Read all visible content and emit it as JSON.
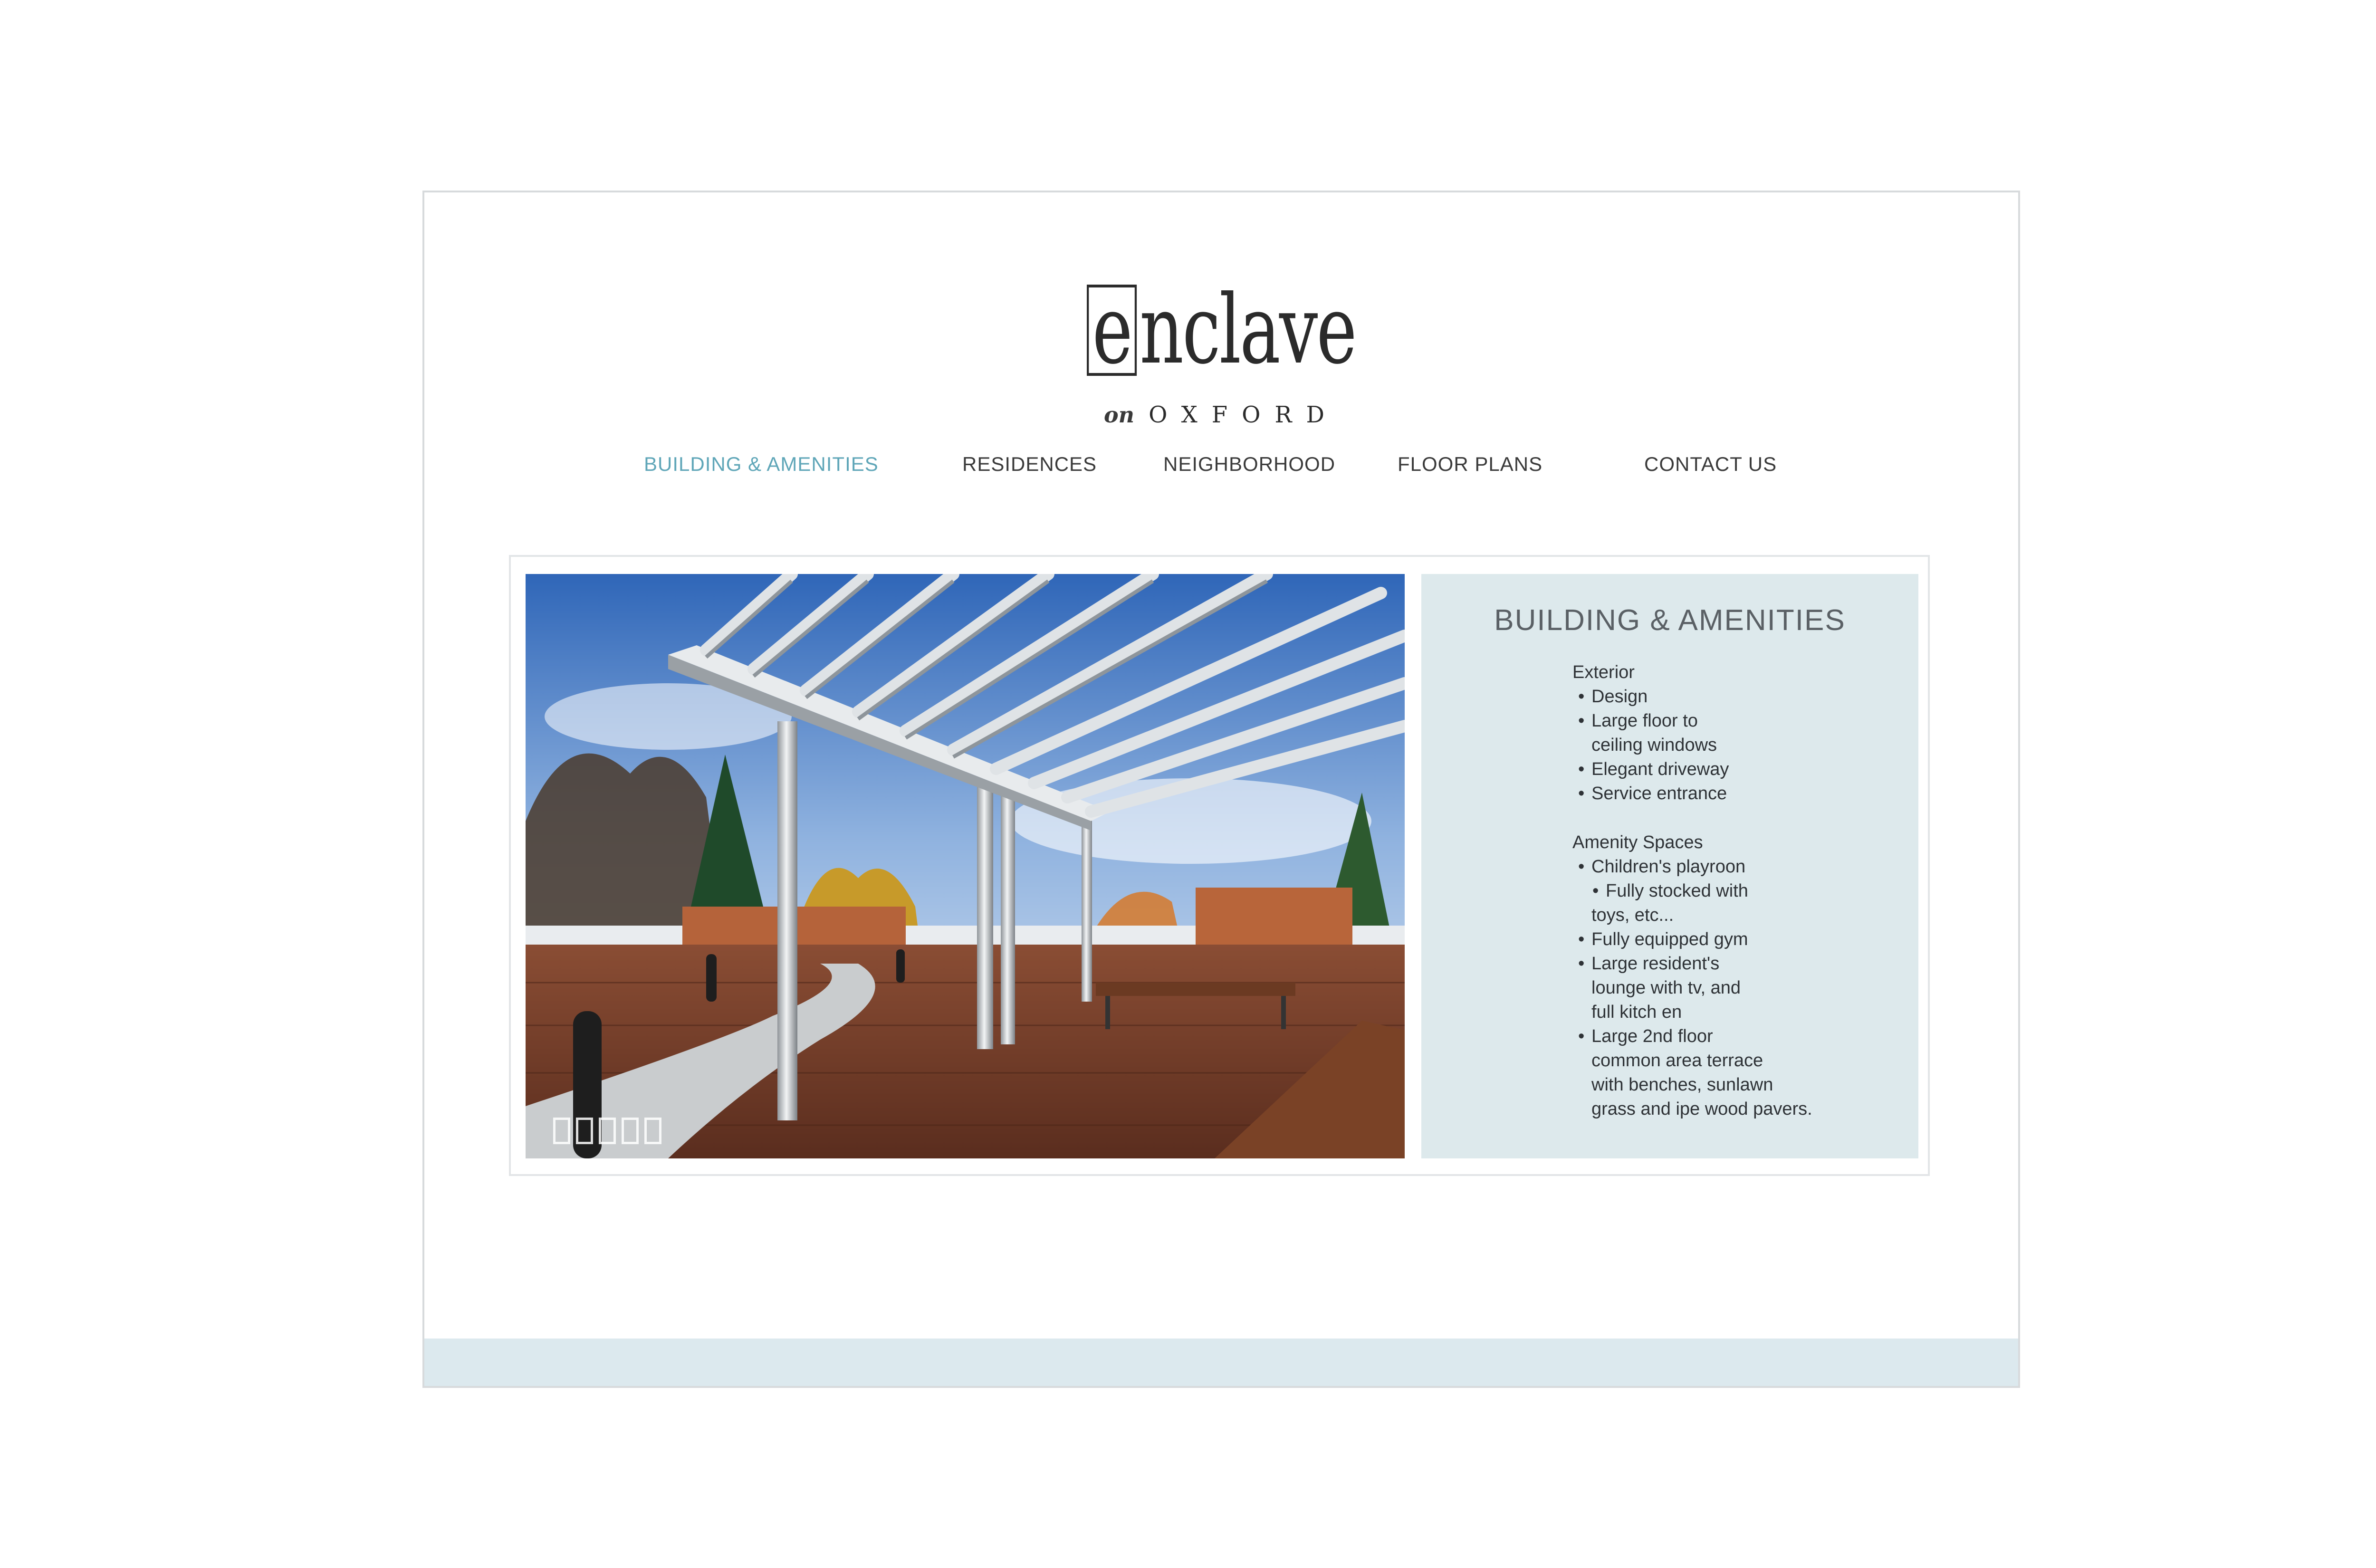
{
  "logo": {
    "first_letter": "e",
    "rest": "nclave",
    "on": "on",
    "place": "OXFORD"
  },
  "nav": {
    "items": [
      {
        "label": "BUILDING & AMENITIES",
        "active": true
      },
      {
        "label": "RESIDENCES",
        "active": false
      },
      {
        "label": "NEIGHBORHOOD",
        "active": false
      },
      {
        "label": "FLOOR PLANS",
        "active": false
      },
      {
        "label": "CONTACT US",
        "active": false
      }
    ]
  },
  "slideshow": {
    "slide_count": 5,
    "current_slide": 1
  },
  "panel": {
    "title": "BUILDING & AMENITIES",
    "exterior": {
      "heading": "Exterior",
      "design": "Design",
      "windows_1": "Large floor to",
      "windows_2": "ceiling windows",
      "driveway": "Elegant driveway",
      "service": "Service entrance"
    },
    "amenity": {
      "heading": "Amenity Spaces",
      "playroom": "Children's playroon",
      "stocked_1": "Fully stocked with",
      "stocked_2": "toys, etc...",
      "gym": "Fully equipped gym",
      "lounge_1": "Large resident's",
      "lounge_2": "lounge with tv, and",
      "lounge_3": "full kitch en",
      "terrace_1": "Large 2nd floor",
      "terrace_2": "common area terrace",
      "terrace_3": "with benches, sunlawn",
      "terrace_4": "grass and ipe wood pavers."
    }
  },
  "colors": {
    "accent": "#5fa6b8",
    "panel_bg": "#dde9ec",
    "footer_bg": "#dce9ee",
    "text": "#2e3236"
  }
}
